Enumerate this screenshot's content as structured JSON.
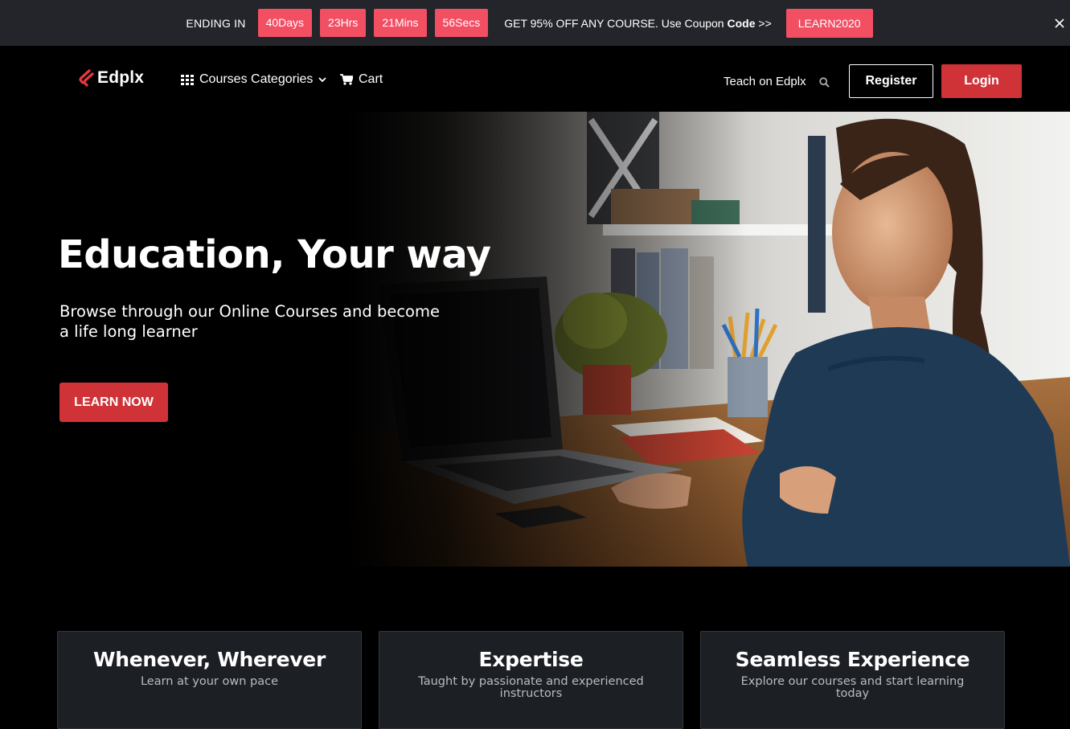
{
  "promo": {
    "ending_label": "ENDING IN",
    "timer": [
      "40Days",
      "23Hrs",
      "21Mins",
      "56Secs"
    ],
    "offer_text": "GET 95% OFF ANY COURSE. Use Coupon ",
    "offer_bold": "Code",
    "offer_arrows": " >>",
    "coupon": "LEARN2020",
    "accent_color": "#f24f63"
  },
  "nav": {
    "brand": "Edplx",
    "courses_categories": "Courses Categories",
    "cart": "Cart",
    "teach": "Teach on Edplx",
    "register": "Register",
    "login": "Login",
    "login_color": "#cf3338"
  },
  "hero": {
    "title": "Education, Your way",
    "subtitle": "Browse through our Online Courses and become a life long learner",
    "cta": "LEARN NOW"
  },
  "features": [
    {
      "title": "Whenever, Wherever",
      "text": "Learn at your own pace"
    },
    {
      "title": "Expertise",
      "text": "Taught by passionate and experienced instructors"
    },
    {
      "title": "Seamless Experience",
      "text": "Explore our courses and start learning today"
    }
  ]
}
